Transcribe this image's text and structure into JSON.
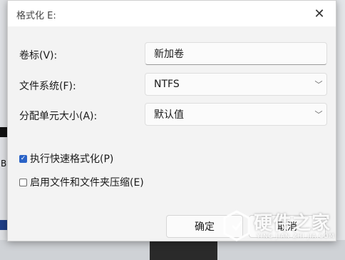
{
  "dialog": {
    "title": "格式化 E:",
    "close_glyph": "✕"
  },
  "form": {
    "volume_label": {
      "label": "卷标(V):",
      "value": "新加卷"
    },
    "file_system": {
      "label": "文件系统(F):",
      "value": "NTFS"
    },
    "allocation_unit": {
      "label": "分配单元大小(A):",
      "value": "默认值"
    },
    "quick_format": {
      "label": "执行快速格式化(P)",
      "checked": true
    },
    "compression": {
      "label": "启用文件和文件夹压缩(E)",
      "checked": false
    }
  },
  "buttons": {
    "ok": "确定",
    "cancel": "取消"
  },
  "icons": {
    "close": "close-icon",
    "dropdown": "chevron-down-icon",
    "check": "checkmark-icon"
  },
  "background": {
    "letter": "B"
  },
  "watermark": {
    "cn": "硬件之家",
    "en": "YING JIAN ZHI JIA.COM"
  },
  "colors": {
    "accent": "#2a63c7",
    "dialog_bg": "#f3f3f3",
    "titlebar_bg": "#ffffff"
  }
}
